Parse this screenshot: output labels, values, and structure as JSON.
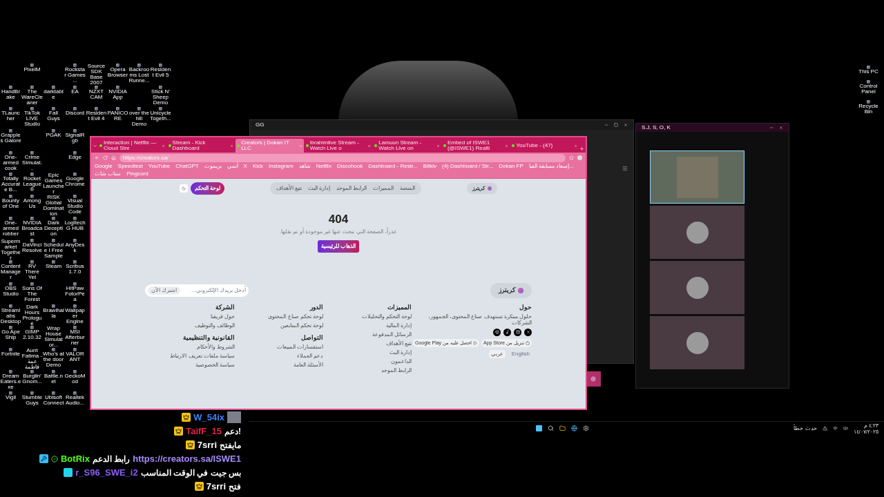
{
  "desktop": {
    "left_icon_rows": [
      [
        null,
        "PixelM",
        null,
        "Rockstar Games ...",
        "Source SDK Base 2007",
        "Opera Browser",
        "Backrooms Lost Runne...",
        "Resident Evil 5"
      ],
      [
        "HandBrake",
        "The WareCleaner",
        "darktable",
        "EA",
        "NZXT CAM",
        "NVIDIA App",
        null,
        "Stick N' Sheep Demo"
      ],
      [
        "TLauncher",
        "TikTok LIVE Studio",
        "Fall Guys",
        "Discord",
        "Resident Evil 4",
        "PANICORE",
        "over the hill Demo",
        "Unicycle Togeth..."
      ],
      [
        "Grapples Galore",
        null,
        "PGAK",
        "SignalRgb"
      ],
      [
        "One-armed cook",
        "Crime Simulat...",
        null,
        "Edge"
      ],
      [
        "Totally Accurate B...",
        "Rocket League®",
        "Epic Games Launcher",
        "Google Chrome"
      ],
      [
        "Bounty of One",
        "Among Us",
        "RISK Global Domination",
        "Visual Studio Code"
      ],
      [
        "One-armed robber",
        "NVIDIA Broadcast",
        "Dark Deception",
        "Logitech G HUB"
      ],
      [
        "Supermarket Together",
        "DaVinci Resolve",
        "Schedule I Free Sample",
        "AnyDesk"
      ],
      [
        "Content Manager",
        "RV There Yet",
        "Steam",
        "Scribus 1.7.0"
      ],
      [
        "OBS Studio",
        "Sons Of The Forest",
        null,
        "HitPaw FotorPea"
      ],
      [
        "Streamlabs Desktop",
        "Dark Hours Prologue",
        "Brawlhalla",
        "Wallpaper Engine"
      ],
      [
        "Go Ape Ship",
        "GIMP 2.10.32",
        "Wrap House Simulator...",
        "MSI Afterburner"
      ],
      [
        "Fortnite",
        "Aunt Fatima - عمة فاطمة",
        "Who's at the door Demo",
        "VALORANT"
      ],
      [
        "Dream Eaters.exe",
        "Burglin' Gnom...",
        "Battle.net",
        "GeckoMod"
      ],
      [
        "Vigil",
        "Stumble Guys",
        "Ubisoft Connect",
        "Realtek Audio..."
      ]
    ],
    "right_icons": [
      "This PC",
      "Control Panel",
      "Recycle Bin"
    ]
  },
  "dark_window": {
    "title": "GG"
  },
  "call_window": {
    "title": "S.J, S, O, K",
    "tiles": [
      {
        "kind": "video"
      },
      {
        "kind": "avatar"
      },
      {
        "kind": "avatar"
      },
      {
        "kind": "avatar"
      }
    ]
  },
  "browser": {
    "tabs": [
      {
        "title": "Interaction | Netflix — Cloud Stre",
        "selected": false
      },
      {
        "title": "Stream - Kick Dashboard",
        "selected": false
      },
      {
        "title": "Creators | Dokan IT LLC",
        "selected": true
      },
      {
        "title": "ibrahimlive Stream - Watch Live o",
        "selected": false
      },
      {
        "title": "Lamuun Stream - Watch Live on",
        "selected": false
      },
      {
        "title": "Embed of ISWE1 (@ISWE1) Realti",
        "selected": false
      },
      {
        "title": "YouTube - (47)",
        "selected": false
      }
    ],
    "url": "https://creators.sa/",
    "bookmarks": [
      "Google",
      "Speedtest",
      "YouTube",
      "ChatGPT",
      "بريموت",
      "أنمي",
      "X",
      "Kick",
      "Instagram",
      "شاهد",
      "Netflix",
      "Discohook",
      "Dashboard - Restr...",
      "Bitkiv",
      "(4) Dashboard / Str...",
      "Dokan FP",
      "إسعاد مسابقة الفيا...",
      "سناب شات",
      "Pingcord"
    ],
    "page": {
      "logo": "كريترز",
      "nav": [
        "المنصة",
        "المميزات",
        "الرابط الموحد",
        "إدارة البث",
        "تتبع الأهداف"
      ],
      "dashboard_button": "لوحة التحكم",
      "error_code": "404",
      "error_message": "عذراً، الصفحة التي تبحث عنها غير موجودة أو تم نقلها.",
      "home_button": "الذهاب للرئيسية",
      "footer": {
        "logo": "كريترز",
        "newsletter": {
          "placeholder": "أدخل بريدك الإلكتروني...",
          "button": "اشترك الآن"
        },
        "about": {
          "heading": "حول",
          "text": "حلول مبتكرة تستهدف صناع المحتوى، الجمهور، الشركات",
          "app_store": "تنزيل من App Store",
          "google_play": "احصل عليه من Google Play",
          "languages": [
            {
              "label": "عربي",
              "selected": true
            },
            {
              "label": "English",
              "selected": false
            }
          ]
        },
        "link_columns": [
          {
            "sections": [
              {
                "heading": "المميزات",
                "links": [
                  "لوحة التحكم والتحليلات",
                  "إدارة المالية",
                  "الرسائل المدفوعة",
                  "تتبع الأهداف",
                  "إدارة البث",
                  "الداعمون",
                  "الرابط الموحد"
                ]
              }
            ]
          },
          {
            "sections": [
              {
                "heading": "الدور",
                "links": [
                  "لوحة تحكم صناع المحتوى",
                  "لوحة تحكم المتابعين"
                ]
              },
              {
                "heading": "التواصل",
                "links": [
                  "استفسارات المبيعات",
                  "دعم العملاء",
                  "الأسئلة العامة"
                ]
              }
            ]
          },
          {
            "sections": [
              {
                "heading": "الشركة",
                "links": [
                  "حول فريقنا",
                  "الوظائف والتوظيف"
                ]
              },
              {
                "heading": "القانونية والتنظيمية",
                "links": [
                  "الشروط والأحكام",
                  "سياسة ملفات تعريف الارتباط",
                  "سياسة الخصوصية"
                ]
              }
            ]
          }
        ]
      }
    }
  },
  "chat": [
    {
      "user": "W_54ix",
      "color": "#3b82f6",
      "badges": [
        {
          "kind": "crown"
        }
      ],
      "kind": "emote"
    },
    {
      "user": "TaifF_15",
      "color": "#e0244a",
      "badges": [
        {
          "kind": "crown"
        }
      ],
      "kind": "text",
      "message": "دعم!"
    },
    {
      "user": "7srri",
      "color": "#ffffff",
      "badges": [
        {
          "kind": "crown"
        }
      ],
      "kind": "text",
      "message": "مايفتح"
    },
    {
      "user": "BotRix",
      "color": "#53fc18",
      "badges": [
        {
          "kind": "bot"
        },
        {
          "kind": "verified"
        }
      ],
      "kind": "text",
      "message": "رابط الدعم",
      "link": "https://creators.sa/ISWE1"
    },
    {
      "user": "r_S96_SWE_i2",
      "color": "#8b5cf6",
      "badges": [
        {
          "kind": "og"
        }
      ],
      "kind": "text",
      "message": "بس جيت في الوقت المناسب"
    },
    {
      "user": "7srri",
      "color": "#ffffff",
      "badges": [
        {
          "kind": "crown"
        }
      ],
      "kind": "text",
      "message": "فتح"
    }
  ],
  "taskbar": {
    "alert": "حدث خطأ",
    "time": "٤:٢٣ م",
    "date": "١٤/٠٧/٢٠٢٥"
  }
}
